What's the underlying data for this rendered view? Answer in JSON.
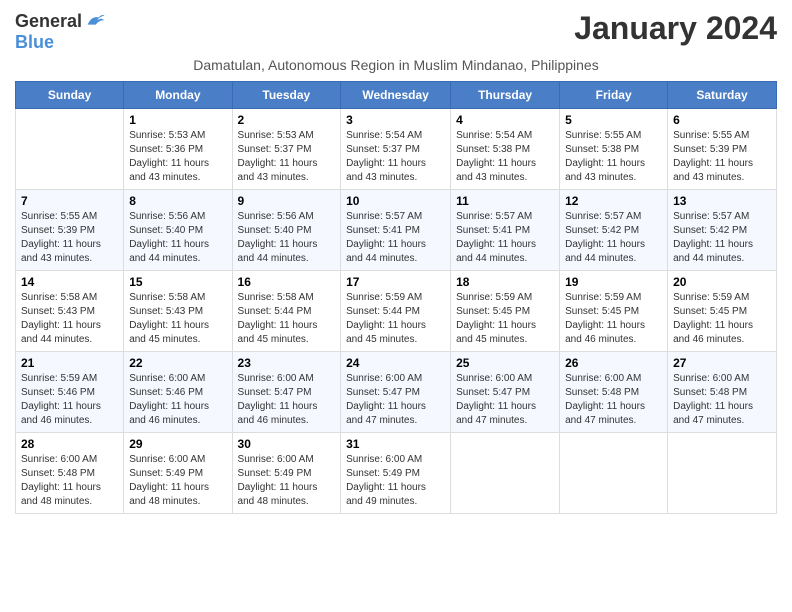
{
  "logo": {
    "general": "General",
    "blue": "Blue"
  },
  "title": "January 2024",
  "subtitle": "Damatulan, Autonomous Region in Muslim Mindanao, Philippines",
  "days_of_week": [
    "Sunday",
    "Monday",
    "Tuesday",
    "Wednesday",
    "Thursday",
    "Friday",
    "Saturday"
  ],
  "weeks": [
    [
      {
        "day": "",
        "info": ""
      },
      {
        "day": "1",
        "info": "Sunrise: 5:53 AM\nSunset: 5:36 PM\nDaylight: 11 hours\nand 43 minutes."
      },
      {
        "day": "2",
        "info": "Sunrise: 5:53 AM\nSunset: 5:37 PM\nDaylight: 11 hours\nand 43 minutes."
      },
      {
        "day": "3",
        "info": "Sunrise: 5:54 AM\nSunset: 5:37 PM\nDaylight: 11 hours\nand 43 minutes."
      },
      {
        "day": "4",
        "info": "Sunrise: 5:54 AM\nSunset: 5:38 PM\nDaylight: 11 hours\nand 43 minutes."
      },
      {
        "day": "5",
        "info": "Sunrise: 5:55 AM\nSunset: 5:38 PM\nDaylight: 11 hours\nand 43 minutes."
      },
      {
        "day": "6",
        "info": "Sunrise: 5:55 AM\nSunset: 5:39 PM\nDaylight: 11 hours\nand 43 minutes."
      }
    ],
    [
      {
        "day": "7",
        "info": "Sunrise: 5:55 AM\nSunset: 5:39 PM\nDaylight: 11 hours\nand 43 minutes."
      },
      {
        "day": "8",
        "info": "Sunrise: 5:56 AM\nSunset: 5:40 PM\nDaylight: 11 hours\nand 44 minutes."
      },
      {
        "day": "9",
        "info": "Sunrise: 5:56 AM\nSunset: 5:40 PM\nDaylight: 11 hours\nand 44 minutes."
      },
      {
        "day": "10",
        "info": "Sunrise: 5:57 AM\nSunset: 5:41 PM\nDaylight: 11 hours\nand 44 minutes."
      },
      {
        "day": "11",
        "info": "Sunrise: 5:57 AM\nSunset: 5:41 PM\nDaylight: 11 hours\nand 44 minutes."
      },
      {
        "day": "12",
        "info": "Sunrise: 5:57 AM\nSunset: 5:42 PM\nDaylight: 11 hours\nand 44 minutes."
      },
      {
        "day": "13",
        "info": "Sunrise: 5:57 AM\nSunset: 5:42 PM\nDaylight: 11 hours\nand 44 minutes."
      }
    ],
    [
      {
        "day": "14",
        "info": "Sunrise: 5:58 AM\nSunset: 5:43 PM\nDaylight: 11 hours\nand 44 minutes."
      },
      {
        "day": "15",
        "info": "Sunrise: 5:58 AM\nSunset: 5:43 PM\nDaylight: 11 hours\nand 45 minutes."
      },
      {
        "day": "16",
        "info": "Sunrise: 5:58 AM\nSunset: 5:44 PM\nDaylight: 11 hours\nand 45 minutes."
      },
      {
        "day": "17",
        "info": "Sunrise: 5:59 AM\nSunset: 5:44 PM\nDaylight: 11 hours\nand 45 minutes."
      },
      {
        "day": "18",
        "info": "Sunrise: 5:59 AM\nSunset: 5:45 PM\nDaylight: 11 hours\nand 45 minutes."
      },
      {
        "day": "19",
        "info": "Sunrise: 5:59 AM\nSunset: 5:45 PM\nDaylight: 11 hours\nand 46 minutes."
      },
      {
        "day": "20",
        "info": "Sunrise: 5:59 AM\nSunset: 5:45 PM\nDaylight: 11 hours\nand 46 minutes."
      }
    ],
    [
      {
        "day": "21",
        "info": "Sunrise: 5:59 AM\nSunset: 5:46 PM\nDaylight: 11 hours\nand 46 minutes."
      },
      {
        "day": "22",
        "info": "Sunrise: 6:00 AM\nSunset: 5:46 PM\nDaylight: 11 hours\nand 46 minutes."
      },
      {
        "day": "23",
        "info": "Sunrise: 6:00 AM\nSunset: 5:47 PM\nDaylight: 11 hours\nand 46 minutes."
      },
      {
        "day": "24",
        "info": "Sunrise: 6:00 AM\nSunset: 5:47 PM\nDaylight: 11 hours\nand 47 minutes."
      },
      {
        "day": "25",
        "info": "Sunrise: 6:00 AM\nSunset: 5:47 PM\nDaylight: 11 hours\nand 47 minutes."
      },
      {
        "day": "26",
        "info": "Sunrise: 6:00 AM\nSunset: 5:48 PM\nDaylight: 11 hours\nand 47 minutes."
      },
      {
        "day": "27",
        "info": "Sunrise: 6:00 AM\nSunset: 5:48 PM\nDaylight: 11 hours\nand 47 minutes."
      }
    ],
    [
      {
        "day": "28",
        "info": "Sunrise: 6:00 AM\nSunset: 5:48 PM\nDaylight: 11 hours\nand 48 minutes."
      },
      {
        "day": "29",
        "info": "Sunrise: 6:00 AM\nSunset: 5:49 PM\nDaylight: 11 hours\nand 48 minutes."
      },
      {
        "day": "30",
        "info": "Sunrise: 6:00 AM\nSunset: 5:49 PM\nDaylight: 11 hours\nand 48 minutes."
      },
      {
        "day": "31",
        "info": "Sunrise: 6:00 AM\nSunset: 5:49 PM\nDaylight: 11 hours\nand 49 minutes."
      },
      {
        "day": "",
        "info": ""
      },
      {
        "day": "",
        "info": ""
      },
      {
        "day": "",
        "info": ""
      }
    ]
  ]
}
